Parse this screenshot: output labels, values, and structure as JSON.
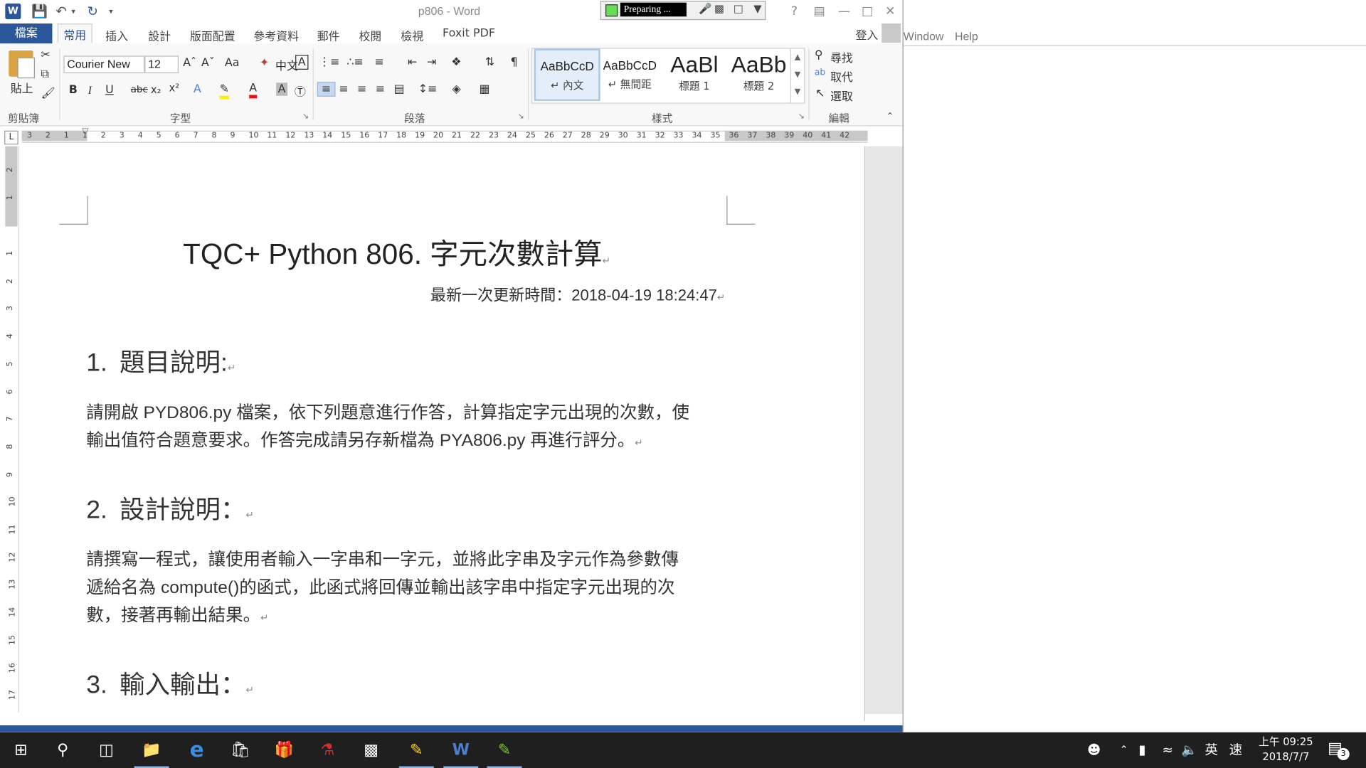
{
  "window": {
    "title": "p806 - Word"
  },
  "preparing": {
    "label": "Preparing ..."
  },
  "background_app": {
    "menu": [
      "Window",
      "Help"
    ]
  },
  "tabs": [
    "檔案",
    "常用",
    "插入",
    "設計",
    "版面配置",
    "參考資料",
    "郵件",
    "校閱",
    "檢視",
    "Foxit PDF"
  ],
  "signin_label": "登入",
  "ribbon": {
    "clipboard": {
      "paste_label": "貼上",
      "group_label": "剪貼簿"
    },
    "font": {
      "name": "Courier New",
      "size": "12",
      "case_label": "Aa",
      "group_label": "字型",
      "phonetic": "中文"
    },
    "paragraph": {
      "group_label": "段落"
    },
    "styles": {
      "group_label": "樣式",
      "items": [
        {
          "sample": "AaBbCcD",
          "name": "↵ 內文"
        },
        {
          "sample": "AaBbCcD",
          "name": "↵ 無間距"
        },
        {
          "sample": "AaBl",
          "name": "標題 1"
        },
        {
          "sample": "AaBb",
          "name": "標題 2"
        }
      ]
    },
    "editing": {
      "group_label": "編輯",
      "find": "尋找",
      "replace": "取代",
      "select": "選取"
    }
  },
  "ruler": {
    "tab_marker": "L",
    "labels": [
      "3",
      "2",
      "1",
      "1",
      "2",
      "3",
      "4",
      "5",
      "6",
      "7",
      "8",
      "9",
      "10",
      "11",
      "12",
      "13",
      "14",
      "15",
      "16",
      "17",
      "18",
      "19",
      "20",
      "21",
      "22",
      "23",
      "24",
      "25",
      "26",
      "27",
      "28",
      "29",
      "30",
      "31",
      "32",
      "33",
      "34",
      "35",
      "36",
      "37",
      "38",
      "39",
      "40",
      "41",
      "42"
    ]
  },
  "vruler": {
    "labels": [
      "2",
      "1",
      "1",
      "2",
      "3",
      "4",
      "5",
      "6",
      "7",
      "8",
      "9",
      "10",
      "11",
      "12",
      "13",
      "14",
      "15",
      "16",
      "17"
    ]
  },
  "document": {
    "title": "TQC+ Python 806.  字元次數計算",
    "update": "最新一次更新時間：2018-04-19 18:24:47",
    "h1_num": "1.",
    "h1_text": "題目說明:",
    "p1_line1": "請開啟 PYD806.py 檔案，依下列題意進行作答，計算指定字元出現的次數，使",
    "p1_line2": "輸出值符合題意要求。作答完成請另存新檔為 PYA806.py 再進行評分。",
    "h2_num": "2.",
    "h2_text": "設計說明：",
    "p2_line1": "請撰寫一程式，讓使用者輸入一字串和一字元，並將此字串及字元作為參數傳",
    "p2_line2": "遞給名為 compute()的函式，此函式將回傳並輸出該字串中指定字元出現的次",
    "p2_line3": "數，接著再輸出結果。",
    "h3_num": "3.",
    "h3_text": "輸入輸出：",
    "para_mark": "↵"
  },
  "taskbar": {
    "ime_lang": "英",
    "ime_mode": "速",
    "time": "上午 09:25",
    "date": "2018/7/7",
    "notification_count": "3"
  },
  "colors": {
    "word_blue": "#2b579a",
    "taskbar": "#1f1f1f"
  }
}
